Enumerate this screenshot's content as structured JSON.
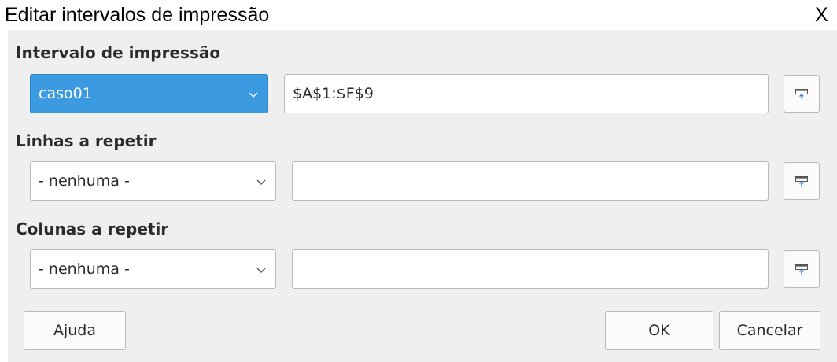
{
  "window": {
    "title": "Editar intervalos de impressão",
    "close_label": "X"
  },
  "print_range": {
    "label": "Intervalo de impressão",
    "selected_option": "caso01",
    "value": "$A$1:$F$9"
  },
  "rows_to_repeat": {
    "label": "Linhas a repetir",
    "selected_option": "- nenhuma -",
    "value": ""
  },
  "columns_to_repeat": {
    "label": "Colunas a repetir",
    "selected_option": "- nenhuma -",
    "value": ""
  },
  "buttons": {
    "help": "Ajuda",
    "ok": "OK",
    "cancel": "Cancelar"
  },
  "colors": {
    "selected_combo": "#3c9ae0",
    "dialog_background": "#efefef"
  },
  "icons": {
    "shrink": "shrink-icon",
    "dropdown": "chevron-down-icon"
  }
}
